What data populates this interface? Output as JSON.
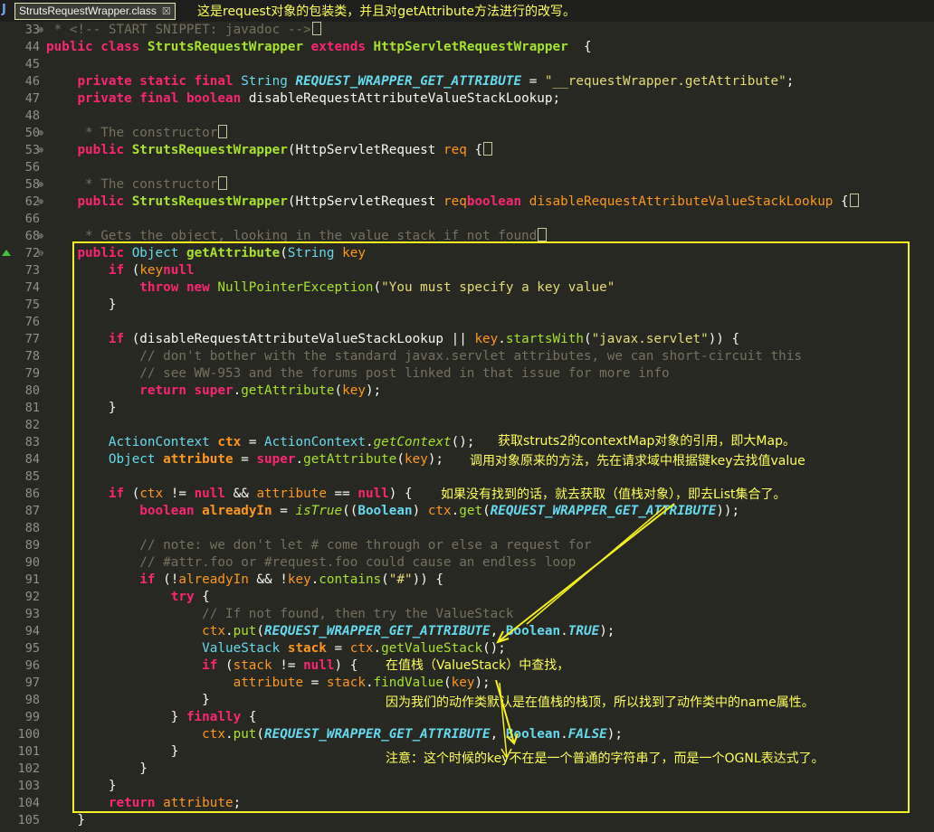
{
  "tab": {
    "icon": "java-file-icon",
    "title": "StrutsRequestWrapper.class",
    "close": "☒"
  },
  "notes": {
    "n_title": "这是request对象的包装类，并且对getAttribute方法进行的改写。",
    "n83": "获取struts2的contextMap对象的引用，即大Map。",
    "n84": "调用对象原来的方法，先在请求域中根据键key去找值value",
    "n86": "如果没有找到的话，就去获取（值栈对象），即去List集合了。",
    "n96": "在值栈（ValueStack）中查找，",
    "n97": "因为我们的动作类默认是在值栈的栈顶，所以找到了动作类中的name属性。",
    "n100": "注意：这个时候的key不在是一个普通的字符串了，而是一个OGNL表达式了。"
  },
  "colors": {
    "background": "#272822",
    "annotation": "#f5f020",
    "keyword": "#f92672"
  },
  "lines": [
    {
      "n": "33",
      "fold": "⊕",
      "code": [
        [
          "cm",
          " * <!-- START SNIPPET: javadoc -->"
        ],
        [
          "fo",
          ""
        ]
      ]
    },
    {
      "n": "44",
      "code": [
        [
          "kw",
          "public class "
        ],
        [
          "fnb",
          "StrutsRequestWrapper "
        ],
        [
          "kw",
          "extends "
        ],
        [
          "fnb",
          "HttpServletRequestWrapper"
        ],
        [
          "",
          "  {"
        ]
      ]
    },
    {
      "n": "45",
      "code": []
    },
    {
      "n": "46",
      "code": [
        [
          "",
          "    "
        ],
        [
          "kw",
          "private static final "
        ],
        [
          "ty",
          "String "
        ],
        [
          "co",
          "REQUEST_WRAPPER_GET_ATTRIBUTE"
        ],
        [
          "",
          " = "
        ],
        [
          "st",
          "\"__requestWrapper.getAttribute\""
        ],
        [
          "",
          ";"
        ]
      ]
    },
    {
      "n": "47",
      "code": [
        [
          "",
          "    "
        ],
        [
          "kw",
          "private final boolean "
        ],
        [
          "",
          "disableRequestAttributeValueStackLookup;"
        ]
      ]
    },
    {
      "n": "48",
      "code": []
    },
    {
      "n": "50",
      "fold": "⊕",
      "code": [
        [
          "cm",
          "     * The constructor"
        ],
        [
          "fo",
          ""
        ]
      ]
    },
    {
      "n": "53",
      "fold": "⊕",
      "code": [
        [
          "",
          "    "
        ],
        [
          "kw",
          "public "
        ],
        [
          "fnb",
          "StrutsRequestWrapper"
        ],
        [
          "",
          "(HttpServletRequest "
        ],
        [
          "pa",
          "req"
        ],
        [
          "",
          " {"
        ],
        [
          "fo",
          ""
        ]
      ]
    },
    {
      "n": "56",
      "code": []
    },
    {
      "n": "58",
      "fold": "⊕",
      "code": [
        [
          "cm",
          "     * The constructor"
        ],
        [
          "fo",
          ""
        ]
      ]
    },
    {
      "n": "62",
      "fold": "⊕",
      "code": [
        [
          "",
          "    "
        ],
        [
          "kw",
          "public "
        ],
        [
          "fnb",
          "StrutsRequestWrapper"
        ],
        [
          "",
          "(HttpServletRequest "
        ],
        [
          "pa",
          "req"
        ],
        [
          ", "
        ],
        [
          "kw",
          "boolean "
        ],
        [
          "pa",
          "disableRequestAttributeValueStackLookup"
        ],
        [
          "",
          " {"
        ],
        [
          "fo",
          ""
        ]
      ]
    },
    {
      "n": "66",
      "code": []
    },
    {
      "n": "68",
      "fold": "⊕",
      "code": [
        [
          "cm",
          "     * Gets the object, looking in the value stack if not found"
        ],
        [
          "fo",
          ""
        ]
      ]
    },
    {
      "n": "72",
      "fold": "⊖",
      "code": [
        [
          "",
          "    "
        ],
        [
          "kw",
          "public "
        ],
        [
          "ty",
          "Object "
        ],
        [
          "fnb",
          "getAttribute"
        ],
        [
          "",
          "("
        ],
        [
          "ty",
          "String "
        ],
        [
          "pa",
          "key"
        ],
        [
          ") {"
        ]
      ]
    },
    {
      "n": "73",
      "code": [
        [
          "",
          "        "
        ],
        [
          "kw",
          "if "
        ],
        [
          "",
          "("
        ],
        [
          "pa",
          "key"
        ],
        [
          " == "
        ],
        [
          "kw",
          "null"
        ],
        [
          ") {"
        ]
      ]
    },
    {
      "n": "74",
      "code": [
        [
          "",
          "            "
        ],
        [
          "kw",
          "throw new "
        ],
        [
          "fn",
          "NullPointerException"
        ],
        [
          "",
          "("
        ],
        [
          "st",
          "\"You must specify a key value\""
        ],
        [
          ");"
        ]
      ]
    },
    {
      "n": "75",
      "code": [
        [
          "",
          "        }"
        ]
      ]
    },
    {
      "n": "76",
      "code": []
    },
    {
      "n": "77",
      "code": [
        [
          "",
          "        "
        ],
        [
          "kw",
          "if "
        ],
        [
          "",
          "(disableRequestAttributeValueStackLookup || "
        ],
        [
          "pa",
          "key"
        ],
        [
          "",
          "."
        ],
        [
          "fn",
          "startsWith"
        ],
        [
          "",
          "("
        ],
        [
          "st",
          "\"javax.servlet\""
        ],
        [
          "",
          ")) {"
        ]
      ]
    },
    {
      "n": "78",
      "code": [
        [
          "",
          "            "
        ],
        [
          "cm",
          "// don't bother with the standard javax.servlet attributes, we can short-circuit this"
        ]
      ]
    },
    {
      "n": "79",
      "code": [
        [
          "",
          "            "
        ],
        [
          "cm",
          "// see WW-953 and the forums post linked in that issue for more info"
        ]
      ]
    },
    {
      "n": "80",
      "code": [
        [
          "",
          "            "
        ],
        [
          "kw",
          "return super"
        ],
        [
          "",
          "."
        ],
        [
          "fn",
          "getAttribute"
        ],
        [
          "",
          "("
        ],
        [
          "pa",
          "key"
        ],
        [
          "",
          ");"
        ]
      ]
    },
    {
      "n": "81",
      "code": [
        [
          "",
          "        }"
        ]
      ]
    },
    {
      "n": "82",
      "code": []
    },
    {
      "n": "83",
      "code": [
        [
          "",
          "        "
        ],
        [
          "ty",
          "ActionContext "
        ],
        [
          "vb",
          "ctx"
        ],
        [
          "",
          " = "
        ],
        [
          "ty",
          "ActionContext"
        ],
        [
          "",
          "."
        ],
        [
          "cs",
          "getContext"
        ],
        [
          "",
          "();"
        ]
      ]
    },
    {
      "n": "84",
      "code": [
        [
          "",
          "        "
        ],
        [
          "ty",
          "Object "
        ],
        [
          "vb",
          "attribute"
        ],
        [
          "",
          " = "
        ],
        [
          "kw",
          "super"
        ],
        [
          "",
          "."
        ],
        [
          "fn",
          "getAttribute"
        ],
        [
          "",
          "("
        ],
        [
          "pa",
          "key"
        ],
        [
          "",
          ");"
        ]
      ]
    },
    {
      "n": "85",
      "code": []
    },
    {
      "n": "86",
      "code": [
        [
          "",
          "        "
        ],
        [
          "kw",
          "if "
        ],
        [
          "",
          "("
        ],
        [
          "pa",
          "ctx"
        ],
        [
          "",
          " != "
        ],
        [
          "kw",
          "null "
        ],
        [
          "",
          "&& "
        ],
        [
          "pa",
          "attribute"
        ],
        [
          "",
          " == "
        ],
        [
          "kw",
          "null"
        ],
        [
          "",
          ") {"
        ]
      ]
    },
    {
      "n": "87",
      "code": [
        [
          "",
          "            "
        ],
        [
          "kw",
          "boolean "
        ],
        [
          "vb",
          "alreadyIn"
        ],
        [
          "",
          " = "
        ],
        [
          "cs",
          "isTrue"
        ],
        [
          "",
          "(("
        ],
        [
          "tyb",
          "Boolean"
        ],
        [
          "",
          ") "
        ],
        [
          "pa",
          "ctx"
        ],
        [
          "",
          "."
        ],
        [
          "fn",
          "get"
        ],
        [
          "",
          "("
        ],
        [
          "co",
          "REQUEST_WRAPPER_GET_ATTRIBUTE"
        ],
        [
          "",
          "));"
        ]
      ]
    },
    {
      "n": "88",
      "code": []
    },
    {
      "n": "89",
      "code": [
        [
          "",
          "            "
        ],
        [
          "cm",
          "// note: we don't let # come through or else a request for"
        ]
      ]
    },
    {
      "n": "90",
      "code": [
        [
          "",
          "            "
        ],
        [
          "cm",
          "// #attr.foo or #request.foo could cause an endless loop"
        ]
      ]
    },
    {
      "n": "91",
      "code": [
        [
          "",
          "            "
        ],
        [
          "kw",
          "if "
        ],
        [
          "",
          "(!"
        ],
        [
          "pa",
          "alreadyIn"
        ],
        [
          "",
          " && !"
        ],
        [
          "pa",
          "key"
        ],
        [
          "",
          "."
        ],
        [
          "fn",
          "contains"
        ],
        [
          "",
          "("
        ],
        [
          "st",
          "\"#\""
        ],
        [
          "",
          ")) {"
        ]
      ]
    },
    {
      "n": "92",
      "code": [
        [
          "",
          "                "
        ],
        [
          "kw",
          "try "
        ],
        [
          "",
          "{"
        ]
      ]
    },
    {
      "n": "93",
      "code": [
        [
          "",
          "                    "
        ],
        [
          "cm",
          "// If not found, then try the ValueStack"
        ]
      ]
    },
    {
      "n": "94",
      "code": [
        [
          "",
          "                    "
        ],
        [
          "pa",
          "ctx"
        ],
        [
          "",
          "."
        ],
        [
          "fn",
          "put"
        ],
        [
          "",
          "("
        ],
        [
          "co",
          "REQUEST_WRAPPER_GET_ATTRIBUTE"
        ],
        [
          "",
          ", "
        ],
        [
          "tyb",
          "Boolean"
        ],
        [
          "",
          "."
        ],
        [
          "co",
          "TRUE"
        ],
        [
          "",
          ");"
        ]
      ]
    },
    {
      "n": "95",
      "code": [
        [
          "",
          "                    "
        ],
        [
          "ty",
          "ValueStack "
        ],
        [
          "vb",
          "stack"
        ],
        [
          "",
          " = "
        ],
        [
          "pa",
          "ctx"
        ],
        [
          "",
          "."
        ],
        [
          "fn",
          "getValueStack"
        ],
        [
          "",
          "();"
        ]
      ]
    },
    {
      "n": "96",
      "code": [
        [
          "",
          "                    "
        ],
        [
          "kw",
          "if "
        ],
        [
          "",
          "("
        ],
        [
          "pa",
          "stack"
        ],
        [
          "",
          " != "
        ],
        [
          "kw",
          "null"
        ],
        [
          "",
          ") {"
        ]
      ]
    },
    {
      "n": "97",
      "code": [
        [
          "",
          "                        "
        ],
        [
          "pa",
          "attribute"
        ],
        [
          "",
          " = "
        ],
        [
          "pa",
          "stack"
        ],
        [
          "",
          "."
        ],
        [
          "fn",
          "findValue"
        ],
        [
          "",
          "("
        ],
        [
          "pa",
          "key"
        ],
        [
          "",
          ");"
        ]
      ]
    },
    {
      "n": "98",
      "code": [
        [
          "",
          "                    }"
        ]
      ]
    },
    {
      "n": "99",
      "code": [
        [
          "",
          "                } "
        ],
        [
          "kw",
          "finally "
        ],
        [
          "",
          "{"
        ]
      ]
    },
    {
      "n": "100",
      "code": [
        [
          "",
          "                    "
        ],
        [
          "pa",
          "ctx"
        ],
        [
          "",
          "."
        ],
        [
          "fn",
          "put"
        ],
        [
          "",
          "("
        ],
        [
          "co",
          "REQUEST_WRAPPER_GET_ATTRIBUTE"
        ],
        [
          "",
          ", "
        ],
        [
          "tyb",
          "Boolean"
        ],
        [
          "",
          "."
        ],
        [
          "co",
          "FALSE"
        ],
        [
          "",
          ");"
        ]
      ]
    },
    {
      "n": "101",
      "code": [
        [
          "",
          "                }"
        ]
      ]
    },
    {
      "n": "102",
      "code": [
        [
          "",
          "            }"
        ]
      ]
    },
    {
      "n": "103",
      "code": [
        [
          "",
          "        }"
        ]
      ]
    },
    {
      "n": "104",
      "code": [
        [
          "",
          "        "
        ],
        [
          "kw",
          "return "
        ],
        [
          "pa",
          "attribute"
        ],
        [
          "",
          ";"
        ]
      ]
    },
    {
      "n": "105",
      "code": [
        [
          "",
          "    }"
        ]
      ]
    }
  ]
}
